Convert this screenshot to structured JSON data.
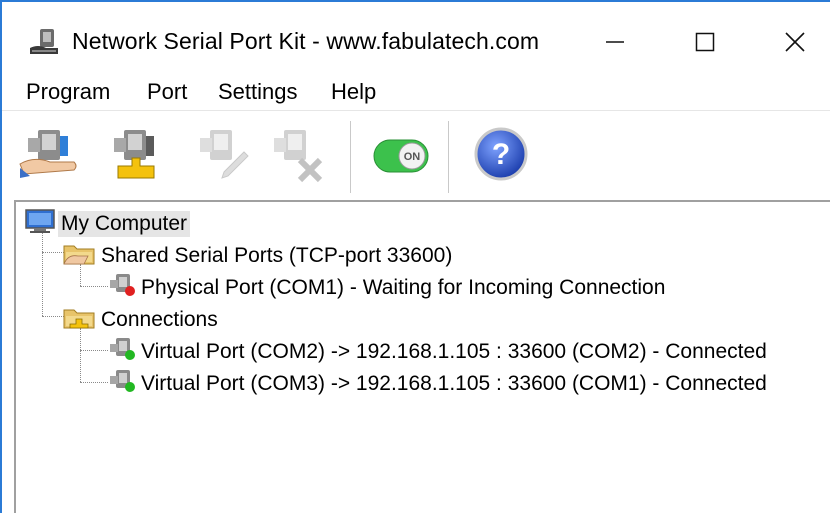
{
  "window": {
    "title": "Network Serial Port Kit - www.fabulatech.com",
    "controls": [
      "minimize",
      "maximize",
      "close"
    ]
  },
  "menu": {
    "program": "Program",
    "port": "Port",
    "settings": "Settings",
    "help": "Help"
  },
  "toolbar": {
    "share_icon": "share-port-icon",
    "connect_icon": "connect-port-icon",
    "edit_icon": "edit-port-icon",
    "delete_icon": "delete-port-icon",
    "toggle_label": "ON",
    "help_icon": "help-icon"
  },
  "tree": {
    "root": "My Computer",
    "shared": {
      "label": "Shared Serial Ports (TCP-port 33600)",
      "items": [
        {
          "label": "Physical Port (COM1) - Waiting for Incoming Connection",
          "status": "red"
        }
      ]
    },
    "connections": {
      "label": "Connections",
      "items": [
        {
          "label": "Virtual Port (COM2) -> 192.168.1.105 : 33600 (COM2) - Connected",
          "status": "green"
        },
        {
          "label": "Virtual Port (COM3) -> 192.168.1.105 : 33600 (COM1) - Connected",
          "status": "green"
        }
      ]
    }
  },
  "colors": {
    "accent_border": "#2b7bd6",
    "toggle_green": "#3cc14c",
    "help_blue": "#2a52c4",
    "status_red": "#e02020",
    "status_green": "#22b822"
  }
}
